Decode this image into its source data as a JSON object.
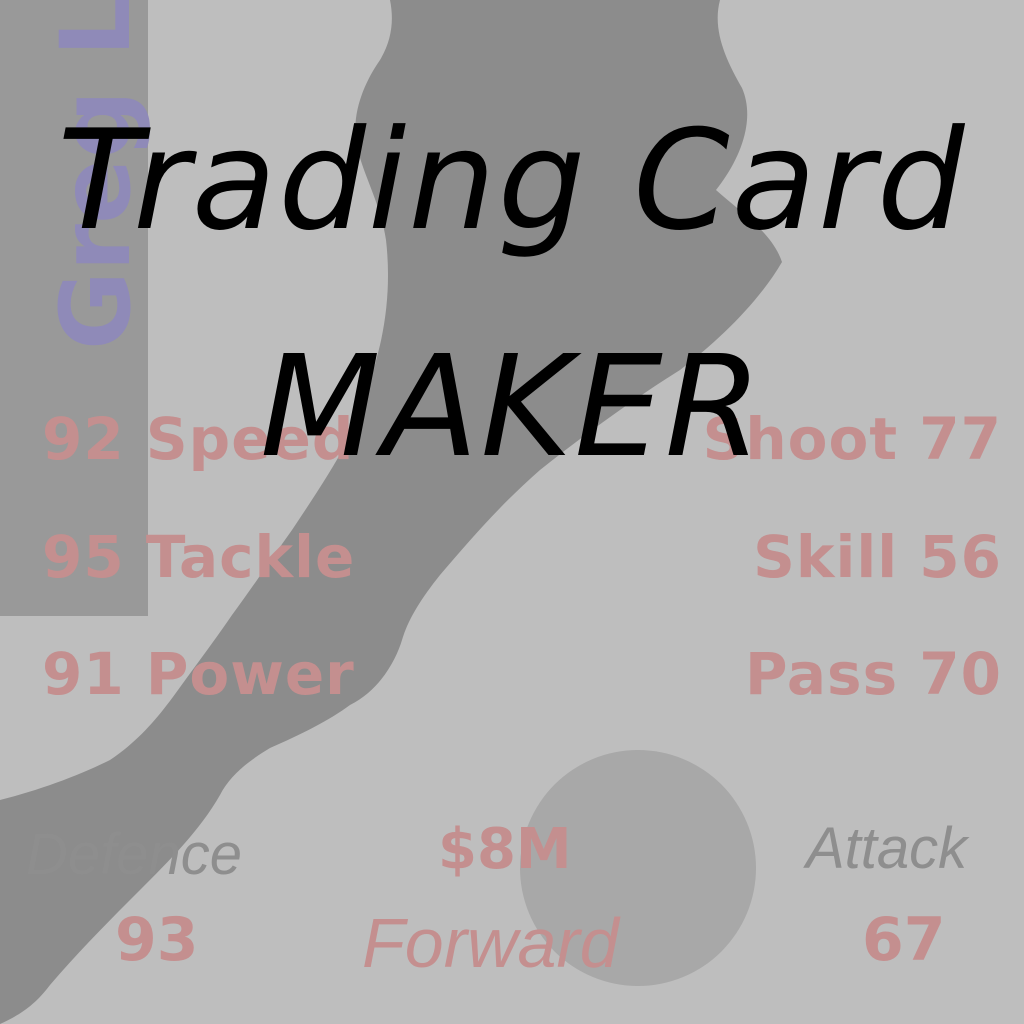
{
  "app_title": {
    "line1": "Trading Card",
    "line2": "MAKER"
  },
  "card": {
    "player_name": "Greg L",
    "stats_left": [
      {
        "label": "92 Speed"
      },
      {
        "label": "95 Tackle"
      },
      {
        "label": "91 Power"
      }
    ],
    "stats_right": [
      {
        "label": "Shoot 77"
      },
      {
        "label": "Skill 56"
      },
      {
        "label": "Pass 70"
      }
    ],
    "defence_label": "Defence",
    "defence_value": "93",
    "attack_label": "Attack",
    "attack_value": "67",
    "price": "$8M",
    "position": "Forward"
  },
  "colors": {
    "background": "#bebebe",
    "stat_text": "#c48f8f",
    "label_text": "#8e8e8e",
    "name_text": "#8f8ab8",
    "silhouette": "#8c8c8c",
    "title_text": "#000000"
  },
  "icons": {
    "player": "soccer-player-silhouette-icon",
    "ball": "ball-icon"
  }
}
